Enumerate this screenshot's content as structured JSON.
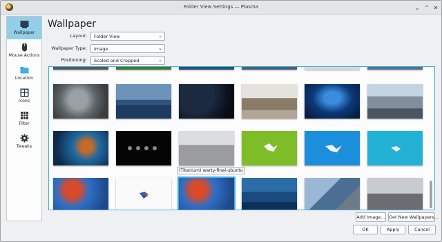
{
  "window": {
    "title": "Folder View Settings — Plasma"
  },
  "sidebar": {
    "items": [
      {
        "label": "Wallpaper",
        "icon": "wallpaper-icon",
        "active": true
      },
      {
        "label": "Mouse Actions",
        "icon": "mouse-icon",
        "active": false
      },
      {
        "label": "Location",
        "icon": "folder-icon",
        "active": false
      },
      {
        "label": "Icons",
        "icon": "icons-grid-icon",
        "active": false
      },
      {
        "label": "Filter",
        "icon": "filter-icon",
        "active": false
      },
      {
        "label": "Tweaks",
        "icon": "gear-icon",
        "active": false
      }
    ]
  },
  "main": {
    "heading": "Wallpaper",
    "layout": {
      "label": "Layout:",
      "value": "Folder View"
    },
    "wallpaper_type": {
      "label": "Wallpaper Type:",
      "value": "Image"
    },
    "positioning": {
      "label": "Positioning:",
      "value": "Scaled and Cropped"
    },
    "tooltip": "(Titanium) warty-final-ubuntu",
    "add_image": "Add Image...",
    "get_new": "Get New Wallpapers..."
  },
  "footer": {
    "ok": "OK",
    "apply": "Apply",
    "cancel": "Cancel"
  },
  "colors": {
    "accent": "#3daee9",
    "selection": "#93cee9",
    "window_bg": "#eff0f1"
  }
}
